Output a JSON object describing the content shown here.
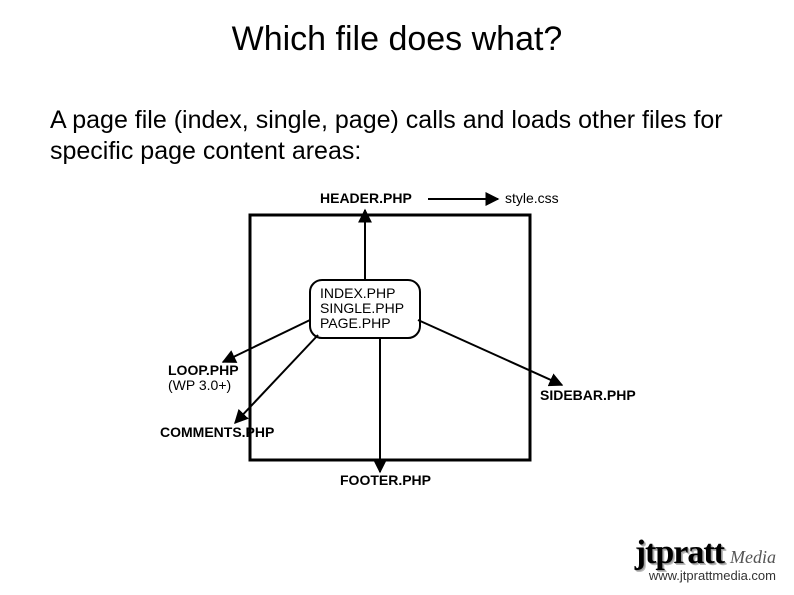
{
  "title": "Which file does what?",
  "subtitle": "A page file (index, single, page) calls and loads other files for specific page content areas:",
  "diagram": {
    "center_box": {
      "line1": "INDEX.PHP",
      "line2": "SINGLE.PHP",
      "line3": "PAGE.PHP"
    },
    "header_label": "HEADER.PHP",
    "style_label": "style.css",
    "sidebar_label": "SIDEBAR.PHP",
    "footer_label": "FOOTER.PHP",
    "comments_label": "COMMENTS.PHP",
    "loop_label": "LOOP.PHP",
    "loop_note": "(WP 3.0+)"
  },
  "logo": {
    "brand": "jtpratt",
    "media": "Media",
    "url": "www.jtprattmedia.com"
  }
}
